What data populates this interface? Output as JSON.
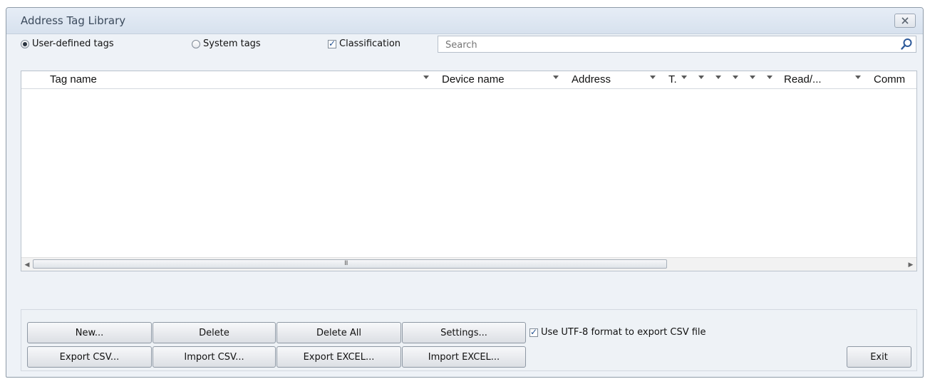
{
  "window": {
    "title": "Address Tag Library"
  },
  "options": {
    "user_defined_label": "User-defined tags",
    "system_label": "System tags",
    "classification_label": "Classification",
    "user_defined_selected": true,
    "system_selected": false,
    "classification_checked": true
  },
  "search": {
    "placeholder": "Search",
    "value": ""
  },
  "grid": {
    "columns": [
      "Tag name",
      "Device name",
      "Address",
      "T.",
      "",
      "",
      "",
      "",
      "Read/...",
      "Comm"
    ],
    "rows": [],
    "scroll_grip": "III"
  },
  "buttons": {
    "new": "New...",
    "delete": "Delete",
    "delete_all": "Delete All",
    "settings": "Settings...",
    "export_csv": "Export CSV...",
    "import_csv": "Import CSV...",
    "export_excel": "Export EXCEL...",
    "import_excel": "Import EXCEL...",
    "exit": "Exit"
  },
  "utf8": {
    "label": "Use UTF-8 format to export CSV file",
    "checked": true
  },
  "icons": {
    "close": "close-icon",
    "search": "search-icon",
    "scroll_left": "chevron-left-icon",
    "scroll_right": "chevron-right-icon"
  },
  "colors": {
    "titlebar": "#dde5f0",
    "window_bg": "#eef2f7",
    "accent": "#1f4f8f"
  }
}
